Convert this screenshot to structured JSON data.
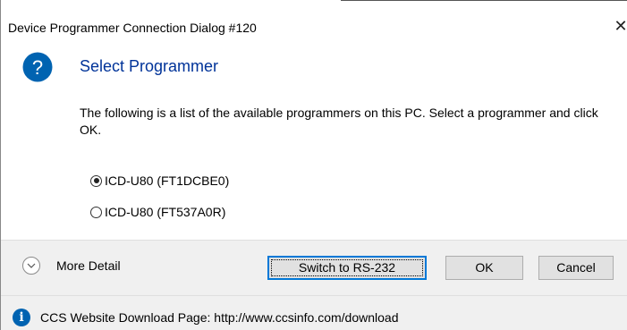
{
  "dialog": {
    "title": "Device Programmer Connection Dialog #120",
    "close_glyph": "✕"
  },
  "main": {
    "icon": "question-icon",
    "icon_glyph": "?",
    "heading": "Select Programmer",
    "description": "The following is a list of the available programmers on this PC.  Select a programmer and click OK.",
    "programmers": [
      {
        "label": "ICD-U80 (FT1DCBE0)",
        "selected": true
      },
      {
        "label": "ICD-U80 (FT537A0R)",
        "selected": false
      }
    ]
  },
  "footer": {
    "more_detail_label": "More Detail",
    "switch_label": "Switch to RS-232",
    "ok_label": "OK",
    "cancel_label": "Cancel"
  },
  "info": {
    "icon": "info-icon",
    "icon_glyph": "i",
    "text": "CCS Website Download Page:  http://www.ccsinfo.com/download"
  },
  "colors": {
    "heading": "#003399",
    "question_icon": "#0063b1",
    "primary_border": "#0078d7",
    "footer_bg": "#f0f0f0"
  }
}
